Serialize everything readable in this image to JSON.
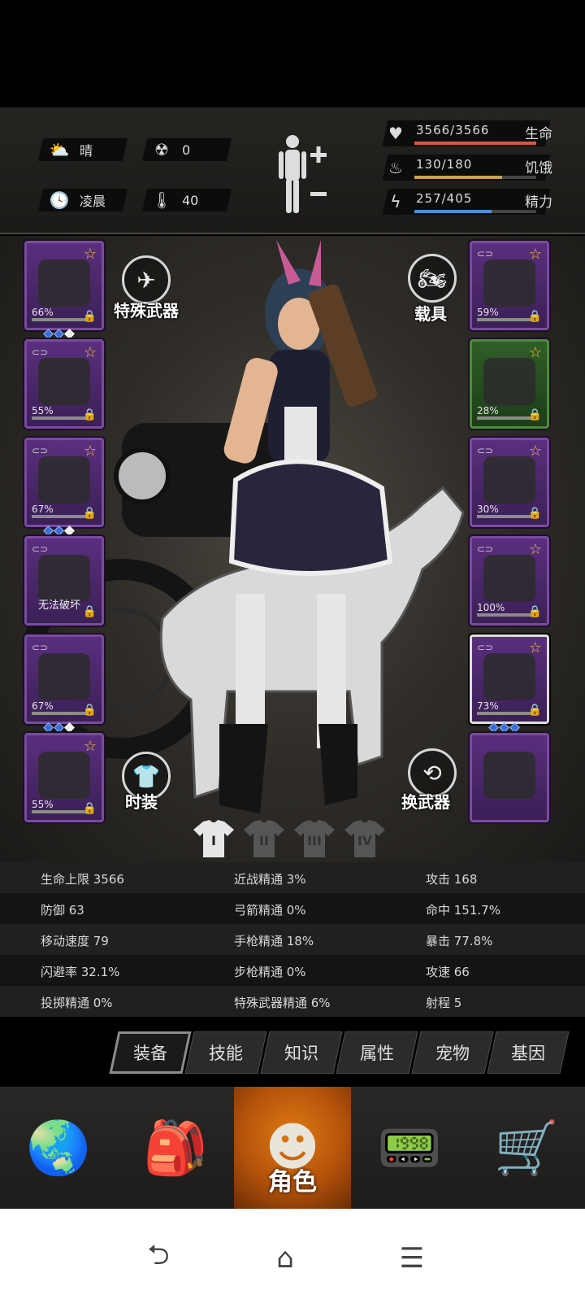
{
  "status": {
    "weather": {
      "icon": "cloud-sun-icon",
      "label": "晴"
    },
    "radiation": {
      "icon": "radiation-icon",
      "value": "0"
    },
    "time": {
      "icon": "clock-icon",
      "label": "凌晨"
    },
    "temperature": {
      "icon": "thermometer-icon",
      "value": "40"
    },
    "body_toggle": {
      "icon": "body-figure-icon"
    },
    "bars": [
      {
        "icon": "heart-icon",
        "text": "3566/3566",
        "label": "生命",
        "fraction": 1.0,
        "color": "#d7574a"
      },
      {
        "icon": "stomach-icon",
        "text": "130/180",
        "label": "饥饿",
        "fraction": 0.722,
        "color": "#c9a24d"
      },
      {
        "icon": "energy-icon",
        "text": "257/405",
        "label": "精力",
        "fraction": 0.635,
        "color": "#4a8fd6"
      }
    ]
  },
  "left_slots": [
    {
      "name": "helmet",
      "pct": "66%",
      "star": true,
      "link": false,
      "gems": [
        "b",
        "b",
        "w"
      ],
      "locked": true
    },
    {
      "name": "shirt",
      "pct": "55%",
      "star": true,
      "link": true,
      "gems": [],
      "locked": true
    },
    {
      "name": "jacket",
      "pct": "67%",
      "star": true,
      "link": true,
      "gems": [
        "b",
        "b",
        "w"
      ],
      "locked": true
    },
    {
      "name": "backpack",
      "pct": "",
      "caption": "无法破坏",
      "star": false,
      "link": true,
      "gems": [],
      "locked": true
    },
    {
      "name": "pants",
      "pct": "67%",
      "star": false,
      "link": true,
      "gems": [
        "b",
        "b",
        "w"
      ],
      "locked": true
    },
    {
      "name": "boots",
      "pct": "55%",
      "star": true,
      "link": false,
      "gems": [],
      "locked": true
    }
  ],
  "right_slots": [
    {
      "name": "goggles",
      "pct": "59%",
      "star": true,
      "link": true,
      "gems": [],
      "locked": true
    },
    {
      "name": "mask",
      "pct": "28%",
      "star": true,
      "link": false,
      "gems": [],
      "locked": true,
      "green": true
    },
    {
      "name": "vest",
      "pct": "30%",
      "star": true,
      "link": true,
      "gems": [],
      "locked": true
    },
    {
      "name": "riot-shield",
      "pct": "100%",
      "star": true,
      "link": true,
      "gems": [],
      "locked": true
    },
    {
      "name": "pistol",
      "pct": "73%",
      "star": true,
      "link": true,
      "gems": [
        "b",
        "b",
        "b"
      ],
      "locked": true,
      "selected": true
    },
    {
      "name": "molotov",
      "pct": "",
      "star": false,
      "link": false,
      "gems": [],
      "locked": false
    }
  ],
  "buttons": {
    "special_weapon": "特殊武器",
    "vehicle": "载具",
    "fashion": "时装",
    "swap_weapon": "换武器"
  },
  "outfit_tabs": [
    "I",
    "II",
    "III",
    "IV"
  ],
  "stats": [
    [
      "生命上限 3566",
      "近战精通 3%",
      "攻击 168"
    ],
    [
      "防御 63",
      "弓箭精通 0%",
      "命中 151.7%"
    ],
    [
      "移动速度 79",
      "手枪精通 18%",
      "暴击 77.8%"
    ],
    [
      "闪避率 32.1%",
      "步枪精通 0%",
      "攻速 66"
    ],
    [
      "投掷精通 0%",
      "特殊武器精通 6%",
      "射程 5"
    ]
  ],
  "sub_tabs": [
    "装备",
    "技能",
    "知识",
    "属性",
    "宠物",
    "基因"
  ],
  "bottom_nav": [
    {
      "icon": "globe-icon",
      "label": ""
    },
    {
      "icon": "backpack-icon",
      "label": ""
    },
    {
      "icon": "head-gear-icon",
      "label": "角色"
    },
    {
      "icon": "radio-icon",
      "label": ""
    },
    {
      "icon": "cart-icon",
      "label": ""
    }
  ],
  "system_nav": [
    "back-icon",
    "home-icon",
    "menu-icon"
  ]
}
